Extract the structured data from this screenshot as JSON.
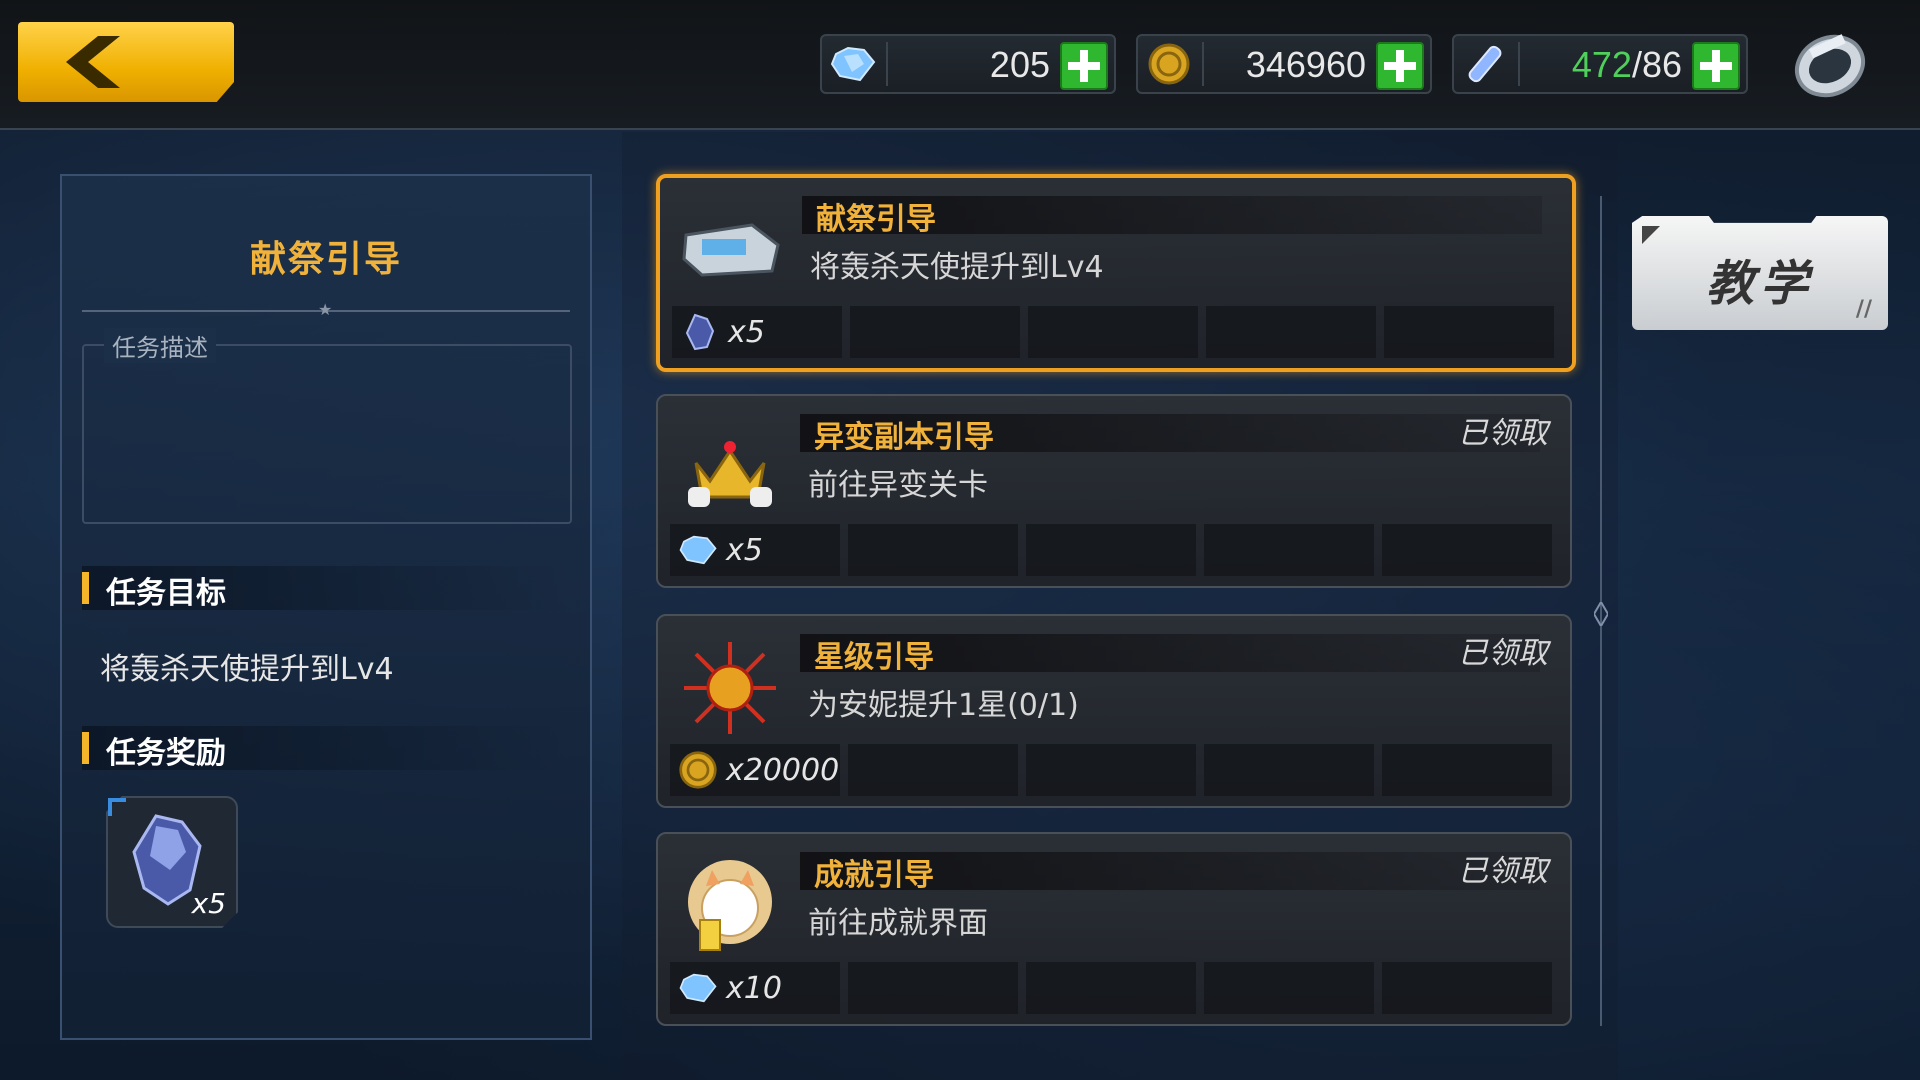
{
  "resources": {
    "diamonds": "205",
    "gold": "346960",
    "energy_current": "472",
    "energy_max": "/86"
  },
  "left_panel": {
    "title": "献祭引导",
    "desc_label": "任务描述",
    "goal_heading": "任务目标",
    "goal_text": "将轰杀天使提升到Lv4",
    "reward_heading": "任务奖励",
    "reward_qty": "x5"
  },
  "quests": [
    {
      "name": "献祭引导",
      "desc": "将轰杀天使提升到Lv4",
      "status": "",
      "reward_icon": "crystal-icon",
      "reward_qty": "x5"
    },
    {
      "name": "异变副本引导",
      "desc": "前往异变关卡",
      "status": "已领取",
      "reward_icon": "diamond-icon",
      "reward_qty": "x5"
    },
    {
      "name": "星级引导",
      "desc": "为安妮提升1星(0/1)",
      "status": "已领取",
      "reward_icon": "gold-coin-icon",
      "reward_qty": "x20000"
    },
    {
      "name": "成就引导",
      "desc": "前往成就界面",
      "status": "已领取",
      "reward_icon": "diamond-icon",
      "reward_qty": "x10"
    }
  ],
  "tutorial_button": "教学",
  "colors": {
    "accent": "#f0b23a",
    "active_border": "#f0a020",
    "plus": "#2fb82f"
  }
}
